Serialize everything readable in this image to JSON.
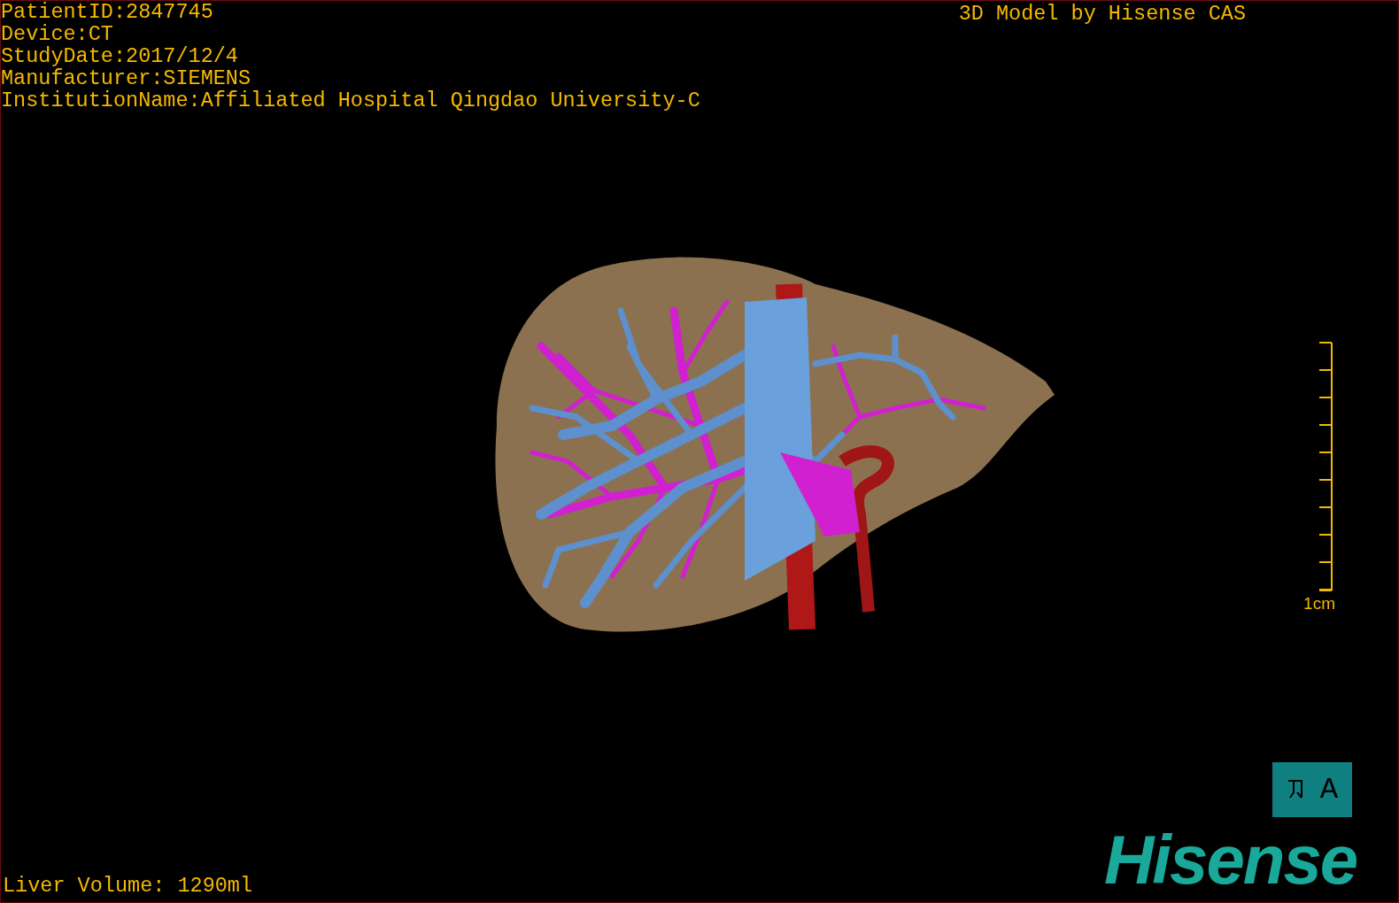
{
  "info_lines": [
    "PatientID:2847745",
    "Device:CT",
    "StudyDate:2017/12/4",
    "Manufacturer:SIEMENS",
    "InstitutionName:Affiliated Hospital Qingdao University-C"
  ],
  "title": "3D Model by Hisense CAS",
  "scale_bar": {
    "label": "1cm"
  },
  "orientation_cube": {
    "label": "A"
  },
  "logo": "Hisense",
  "liver_volume": "Liver Volume: 1290ml"
}
